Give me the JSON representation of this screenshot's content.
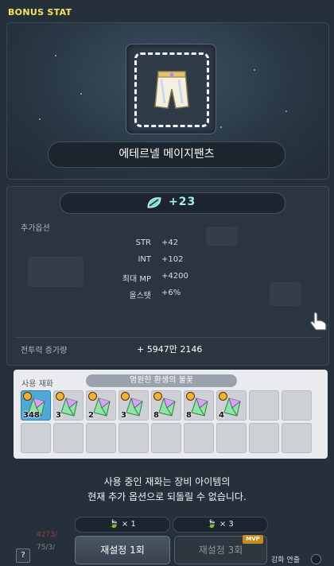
{
  "window": {
    "title": "BONUS STAT"
  },
  "item": {
    "name": "에테르넬 메이지팬츠"
  },
  "flame": {
    "value": "+23"
  },
  "options": {
    "label": "추가옵션",
    "rows": [
      {
        "name": "STR",
        "value": "+42"
      },
      {
        "name": "INT",
        "value": "+102"
      },
      {
        "name": "최대 MP",
        "value": "+4200"
      },
      {
        "name": "올스탯",
        "value": "+6%"
      }
    ]
  },
  "combat_power": {
    "label": "전투력 증가량",
    "value": "+ 5947만 2146"
  },
  "materials": {
    "label": "사용 재화",
    "selected_name": "영원한 환생의 불꽃",
    "slots": [
      {
        "count": "348",
        "selected": true
      },
      {
        "count": "3",
        "selected": false
      },
      {
        "count": "2",
        "selected": false
      },
      {
        "count": "3",
        "selected": false
      },
      {
        "count": "8",
        "selected": false
      },
      {
        "count": "8",
        "selected": false
      },
      {
        "count": "4",
        "selected": false
      }
    ]
  },
  "warning": {
    "line1": "사용 중인 재화는 장비 아이템의",
    "line2": "현재 추가 옵션으로 되돌릴 수 없습니다."
  },
  "costs": [
    {
      "text": "× 1"
    },
    {
      "text": "× 3"
    }
  ],
  "buttons": {
    "reset1": "재설정 1회",
    "reset3": "재설정 3회",
    "mvp_badge": "MVP"
  },
  "help": {
    "label": "?"
  },
  "enhance_toggle": {
    "label": "강화 연출"
  },
  "background": {
    "hp_text": "4273/",
    "hp_text2": "75/3/"
  }
}
